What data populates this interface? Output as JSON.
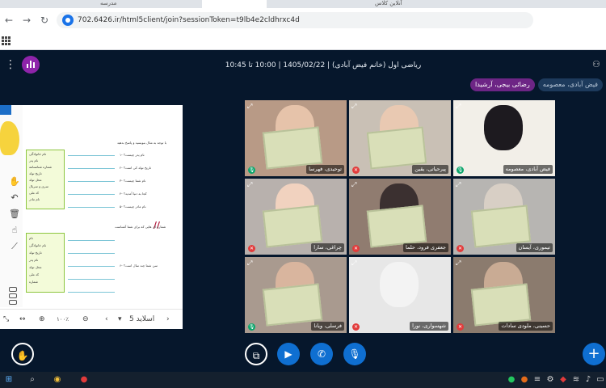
{
  "browser": {
    "tabs": [
      "مدرسه",
      "",
      "آنلاین کلاس"
    ],
    "url": "702.6426.ir/html5client/join?sessionToken=t9lb4e2cldhrxc4d"
  },
  "app": {
    "meeting_title": "ریاضی اول (خانم فیض آبادی) | 1405/02/22 | 10:00 تا 10:45",
    "talking": [
      "فیض آبادی، معصومه",
      "رضائی بیجی، آرشیدا"
    ]
  },
  "presentation": {
    "slide_label": "اسلاید 5",
    "zoom": "۱۰۰٪",
    "slide_texts": {
      "heading1": "با توجه به مثال بنویسید و پاسخ بدهید",
      "heading2": "شماره ای هایی که برای شما آشناست",
      "q1": "۱- نام پدر چیست؟",
      "q2": "۲- تاریخ تولد کی است؟",
      "q3": "۳- نام شما چیست؟",
      "q4": "۴- کجا به دنیا آمدید؟",
      "q5": "۵- نام مادر چیست؟",
      "q6": "۶- سن شما چند سال است؟"
    },
    "box1_items": [
      "نام خانوادگی",
      "نام پدر",
      "شماره شناسنامه",
      "تاریخ تولد",
      "محل تولد",
      "سری و سریال",
      "کد ملی",
      "نام مادر"
    ],
    "box2_items": [
      "نام",
      "نام خانوادگی",
      "تاریخ تولد",
      "نام پدر",
      "محل تولد",
      "کد ملی",
      "شماره"
    ]
  },
  "participants": [
    {
      "name": "توحیدی، فهرسا",
      "mic": "on",
      "bg": "#b89a86",
      "person": "#e6c3aa",
      "cert": true
    },
    {
      "name": "پیرحیاتی، یقین",
      "mic": "off",
      "bg": "#c9c0b5",
      "person": "#e9c9b2",
      "cert": true
    },
    {
      "name": "فیض آبادی، معصومه",
      "mic": "on",
      "bg": "#f2efe8",
      "person": "#1d1a1f",
      "cert": false
    },
    {
      "name": "چراغی، سارا",
      "mic": "off",
      "bg": "#b8b1ad",
      "person": "#f1d2bf",
      "cert": true
    },
    {
      "name": "جعفری فرود، حلما",
      "mic": "off",
      "bg": "#907c70",
      "person": "#3b3030",
      "cert": true
    },
    {
      "name": "تیموری، آیسان",
      "mic": "off",
      "bg": "#b7b5b2",
      "person": "#d8cfc5",
      "cert": true
    },
    {
      "name": "فرسلی، ویانا",
      "mic": "on",
      "bg": "#a99a8f",
      "person": "#d9b59e",
      "cert": true
    },
    {
      "name": "شهسواری، نورا",
      "mic": "off",
      "bg": "#e7e7e7",
      "person": "#f3f3f3",
      "cert": false
    },
    {
      "name": "حسینی، ملودی سادات",
      "mic": "off",
      "bg": "#8b7b6e",
      "person": "#c9ab94",
      "cert": true
    }
  ],
  "colors": {
    "app_bg": "#06172c",
    "accent_blue": "#0f6fd1",
    "talker_purple": "#6d2585",
    "mic_on": "#0aa56b",
    "mic_off": "#e23b3b"
  },
  "icons": {
    "tile_expand": "⤢",
    "mic_on": "🎙",
    "mic_off": "✕"
  }
}
